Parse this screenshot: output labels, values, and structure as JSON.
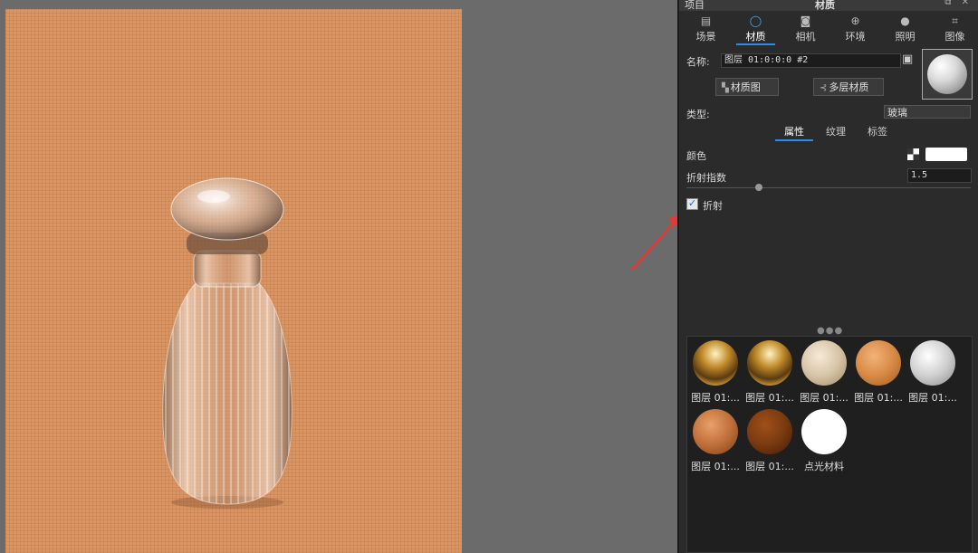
{
  "panel": {
    "title_left": "项目",
    "title_center": "材质",
    "title_icons": "⧉ ✕"
  },
  "tabs": [
    {
      "label": "场景",
      "icon": "scene-icon"
    },
    {
      "label": "材质",
      "icon": "material-icon",
      "active": true
    },
    {
      "label": "相机",
      "icon": "camera-icon"
    },
    {
      "label": "环境",
      "icon": "globe-icon"
    },
    {
      "label": "照明",
      "icon": "bulb-icon"
    },
    {
      "label": "图像",
      "icon": "image-icon"
    }
  ],
  "material": {
    "name_label": "名称:",
    "name_value": "图层 01:0:0:0 #2",
    "material_graph_button": "材质图",
    "multilayer_button": "多层材质",
    "type_label": "类型:",
    "type_value": "玻璃",
    "subtabs": [
      {
        "label": "属性",
        "active": true
      },
      {
        "label": "纹理"
      },
      {
        "label": "标签"
      }
    ],
    "color_label": "颜色",
    "color_value": "#ffffff",
    "ior_label": "折射指数",
    "ior_value": "1.5",
    "refraction_label": "折射",
    "refraction_checked": true
  },
  "library": {
    "items": [
      {
        "label": "图层 01:...",
        "color": "gold-env"
      },
      {
        "label": "图层 01:...",
        "color": "gold-env"
      },
      {
        "label": "图层 01:...",
        "color": "beige"
      },
      {
        "label": "图层 01:...",
        "color": "orange"
      },
      {
        "label": "图层 01:...",
        "color": "silver"
      },
      {
        "label": "图层 01:...",
        "color": "copper"
      },
      {
        "label": "图层 01:...",
        "color": "brown"
      },
      {
        "label": "点光材料",
        "color": "white"
      }
    ]
  },
  "colors": {
    "accent": "#2d8ceb",
    "panel_bg": "#2b2b2b",
    "backdrop": "#d99462",
    "annotation_arrow": "#e53935"
  }
}
